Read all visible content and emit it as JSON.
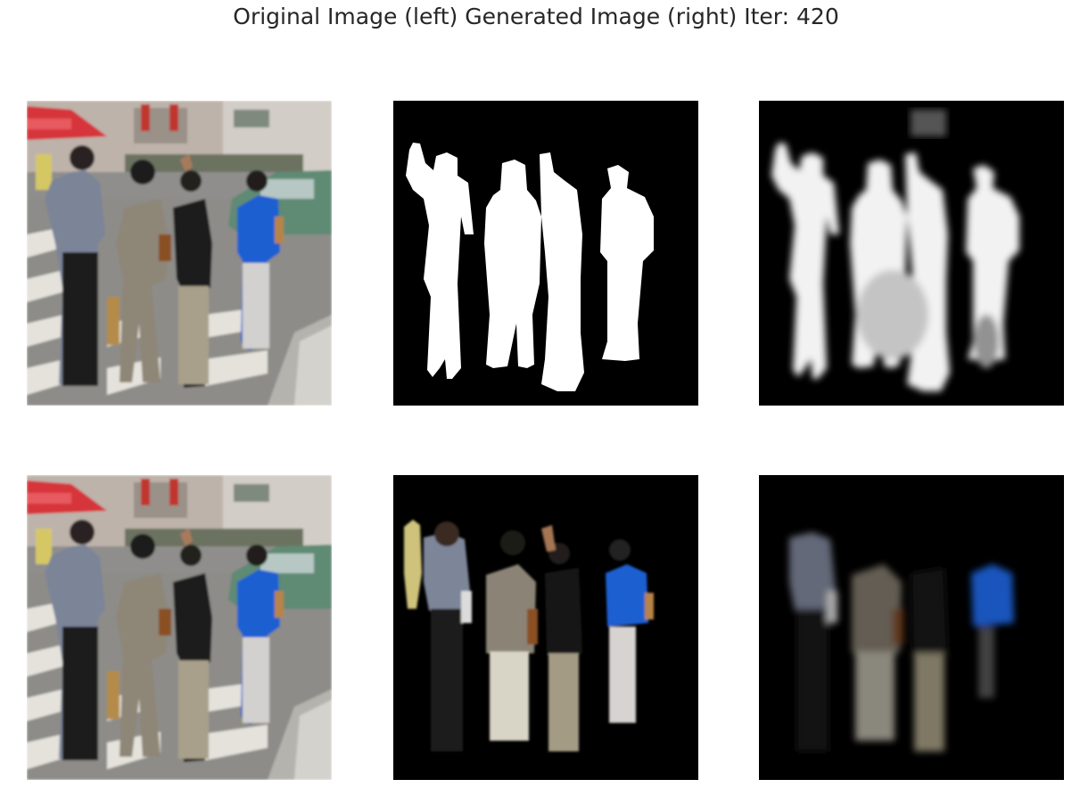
{
  "figure": {
    "title": "Original Image (left) Generated Image (right) Iter: 420"
  },
  "panels": [
    {
      "row": 0,
      "col": 0,
      "kind": "photo"
    },
    {
      "row": 0,
      "col": 1,
      "kind": "mask"
    },
    {
      "row": 0,
      "col": 2,
      "kind": "mask-pred"
    },
    {
      "row": 1,
      "col": 0,
      "kind": "photo"
    },
    {
      "row": 1,
      "col": 1,
      "kind": "masked-photo"
    },
    {
      "row": 1,
      "col": 2,
      "kind": "masked-photo-pred"
    }
  ],
  "colors": {
    "background": "#ffffff",
    "title_text": "#262626",
    "mask_bg": "#000000",
    "mask_fg": "#ffffff",
    "shirt_blue": "#1a5fd1",
    "street_gray": "#8c8c8a"
  }
}
